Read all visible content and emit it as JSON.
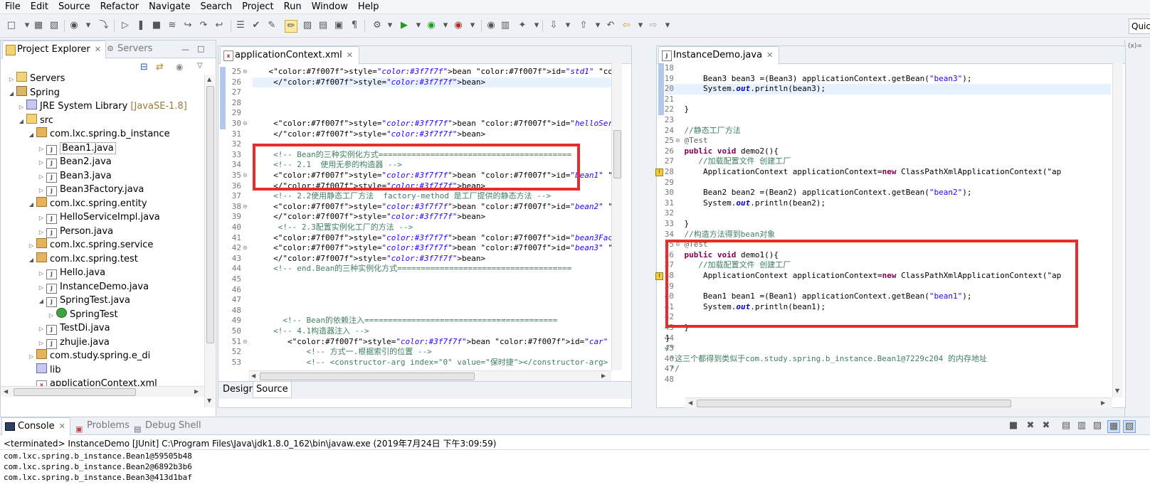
{
  "menu": [
    "File",
    "Edit",
    "Source",
    "Refactor",
    "Navigate",
    "Search",
    "Project",
    "Run",
    "Window",
    "Help"
  ],
  "quick_access": "Quic",
  "far_right_label": "(x)=",
  "explorer": {
    "tab_label": "Project Explorer",
    "close": "✕",
    "servers_tab_label": "Servers",
    "tree": [
      {
        "label": "Servers",
        "suffix": ""
      },
      {
        "label": "Spring",
        "suffix": ""
      },
      {
        "label": "JRE System Library",
        "suffix": " [JavaSE-1.8]"
      },
      {
        "label": "src",
        "suffix": ""
      },
      {
        "label": "com.lxc.spring.b_instance",
        "suffix": ""
      },
      {
        "label": "Bean1.java",
        "suffix": ""
      },
      {
        "label": "Bean2.java",
        "suffix": ""
      },
      {
        "label": "Bean3.java",
        "suffix": ""
      },
      {
        "label": "Bean3Factory.java",
        "suffix": ""
      },
      {
        "label": "com.lxc.spring.entity",
        "suffix": ""
      },
      {
        "label": "HelloServiceImpl.java",
        "suffix": ""
      },
      {
        "label": "Person.java",
        "suffix": ""
      },
      {
        "label": "com.lxc.spring.service",
        "suffix": ""
      },
      {
        "label": "com.lxc.spring.test",
        "suffix": ""
      },
      {
        "label": "Hello.java",
        "suffix": ""
      },
      {
        "label": "InstanceDemo.java",
        "suffix": ""
      },
      {
        "label": "SpringTest.java",
        "suffix": ""
      },
      {
        "label": "SpringTest",
        "suffix": ""
      },
      {
        "label": "TestDi.java",
        "suffix": ""
      },
      {
        "label": "zhujie.java",
        "suffix": ""
      },
      {
        "label": "com.study.spring.e_di",
        "suffix": ""
      },
      {
        "label": "lib",
        "suffix": ""
      },
      {
        "label": "applicationContext.xml",
        "suffix": ""
      }
    ]
  },
  "xml_editor": {
    "tab_label": "applicationContext.xml",
    "bottom_tabs": [
      "Design",
      "Source"
    ],
    "line_numbers": [
      "25",
      "26",
      "27",
      "28",
      "29",
      "30",
      "31",
      "32",
      "33",
      "34",
      "35",
      "36",
      "37",
      "38",
      "39",
      "40",
      "41",
      "42",
      "43",
      "44",
      "45",
      "46",
      "47",
      "48",
      "49",
      "50",
      "51",
      "52",
      "53"
    ],
    "lines": [
      "    <bean id=\"std1\" class=\"com.lxc.spring.service.biaoqianzhuru\">",
      "     </bean>",
      "",
      "",
      "",
      "     <bean id=\"helloServices\" class=\"com.lxc.spring.entity.HelloServiceImpl",
      "     </bean>",
      "",
      "     <!-- Bean的三种实例化方式=========================================",
      "     <!-- 2.1  使用无参的构造器 -->",
      "     <bean id=\"bean1\" class=\"com.lxc.spring.b_instance.Bean1\">",
      "     </bean>",
      "     <!-- 2.2使用静态工厂方法  factory-method 是工厂提供的静态方法 -->",
      "     <bean id=\"bean2\" class=\"com.lxc.spring.b_instance.Bean2\" factory-metho",
      "     </bean>",
      "      <!-- 2.3配置实例化工厂的方法 -->",
      "     <bean id=\"bean3Factory\" class=\"com.lxc.spring.b_instance.Bean3Factory\"",
      "     <bean id=\"bean3\" factory-bean=\"bean3Factory\" factory-method=\"getInstan",
      "     </bean>",
      "     <!-- end.Bean的三种实例化方式=====================================",
      "",
      "",
      "",
      "",
      "       <!-- Bean的依赖注入=========================================",
      "     <!-- 4.1构造器注入 -->",
      "        <bean id=\"car\" class=\"com.study.spring.e_di.Car\">",
      "            <!-- 方式一.根据索引的位置 -->",
      "            <!-- <constructor-arg index=\"0\" value=\"保时捷\"></constructor-arg>"
    ]
  },
  "java_editor": {
    "tab_label": "InstanceDemo.java",
    "line_numbers": [
      "18",
      "19",
      "20",
      "21",
      "22",
      "23",
      "24",
      "25",
      "26",
      "27",
      "28",
      "29",
      "30",
      "31",
      "32",
      "33",
      "34",
      "35",
      "36",
      "37",
      "38",
      "39",
      "40",
      "41",
      "42",
      "43",
      "44",
      "45",
      "46",
      "47",
      "48"
    ],
    "lines": [
      "",
      "        Bean3 bean3 =(Bean3) applicationContext.getBean(\"bean3\");",
      "        System.out.println(bean3);",
      "",
      "    }",
      "",
      "    //静态工厂方法",
      "    @Test",
      "    public void demo2(){",
      "       //加载配置文件 创建工厂",
      "        ApplicationContext applicationContext=new ClassPathXmlApplicationContext(\"ap",
      "",
      "        Bean2 bean2 =(Bean2) applicationContext.getBean(\"bean2\");",
      "        System.out.println(bean2);",
      "",
      "    }",
      "    //构造方法得到bean对象",
      "    @Test",
      "    public void demo1(){",
      "       //加载配置文件 创建工厂",
      "        ApplicationContext applicationContext=new ClassPathXmlApplicationContext(\"ap",
      "",
      "        Bean1 bean1 =(Bean1) applicationContext.getBean(\"bean1\");",
      "        System.out.println(bean1);",
      "",
      "    }",
      "}",
      "/*",
      " *这三个都得到类似于com.study.spring.b_instance.Bean1@7229c204 的内存地址",
      " */",
      ""
    ]
  },
  "console": {
    "tabs": [
      "Console",
      "Problems",
      "Debug Shell"
    ],
    "status": "<terminated> InstanceDemo [JUnit] C:\\Program Files\\Java\\jdk1.8.0_162\\bin\\javaw.exe (2019年7月24日 下午3:09:59)",
    "output": [
      "com.lxc.spring.b_instance.Bean1@59505b48",
      "com.lxc.spring.b_instance.Bean2@6892b3b6",
      "com.lxc.spring.b_instance.Bean3@413d1baf"
    ]
  },
  "colors": {
    "highlight_box": "#e72c2c",
    "keyword": "#7f0055",
    "string": "#2a00ff",
    "comment": "#3f7f5f",
    "xml_tag": "#3f7f7f",
    "xml_attr": "#7f007f"
  }
}
